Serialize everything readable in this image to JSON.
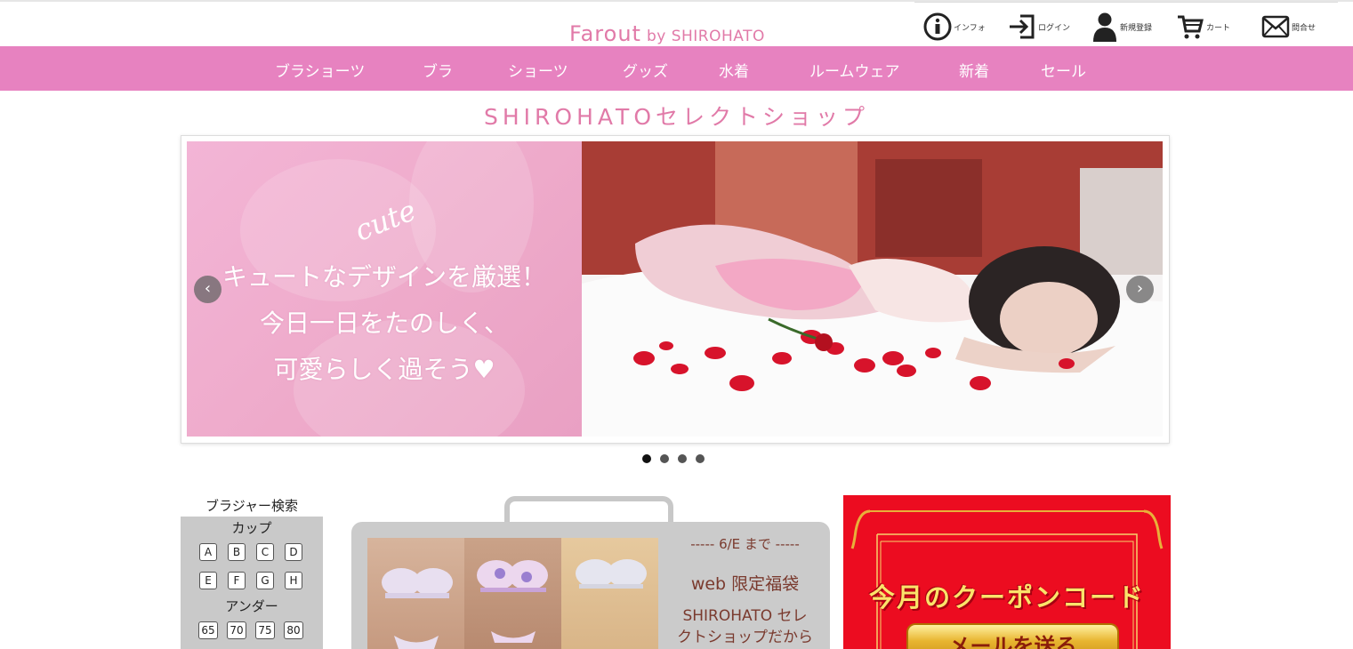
{
  "header": {
    "logo_main": "Farout",
    "logo_by": "by SHIROHATO",
    "utility": {
      "info": "インフォ",
      "login": "ログイン",
      "register": "新規登録",
      "cart": "カート",
      "contact": "問合せ"
    }
  },
  "nav": [
    "ブラショーツ",
    "ブラ",
    "ショーツ",
    "グッズ",
    "水着",
    "ルームウェア",
    "新着",
    "セール"
  ],
  "shop_title": "SHIROHATOセレクトショップ",
  "slider": {
    "cute": "cute",
    "line1": "キュートなデザインを厳選！",
    "line2": "今日一日をたのしく、",
    "line3": "可愛らしく過そう♥",
    "prev": "‹",
    "next": "›",
    "slide_count": 4,
    "active_slide": 1
  },
  "bra_search": {
    "title": "ブラジャー検索",
    "cup_label": "カップ",
    "cups": [
      "A",
      "B",
      "C",
      "D",
      "E",
      "F",
      "G",
      "H"
    ],
    "under_label": "アンダー",
    "unders": [
      "65",
      "70",
      "75",
      "80"
    ]
  },
  "promo": {
    "date": "-----   6/E まで   -----",
    "title": "web 限定福袋",
    "desc_line1": "SHIROHATO セレ",
    "desc_line2": "クトショップだから"
  },
  "coupon": {
    "text": "今月のクーポンコード",
    "button": "メールを送る"
  },
  "colors": {
    "nav_pink": "#e782c0",
    "logo_pink": "#e17aa8",
    "coupon_red": "#ec0c20"
  }
}
